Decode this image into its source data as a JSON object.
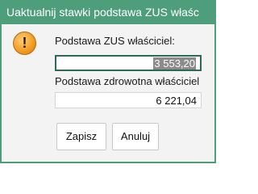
{
  "window": {
    "title": "Uaktualnij stawki podstawa ZUS właśc"
  },
  "form": {
    "zus_label": "Podstawa ZUS właściciel:",
    "zus_value": "3 553,20",
    "health_label": "Podstawa zdrowotna właściciel",
    "health_value": "6 221,04"
  },
  "buttons": {
    "save": "Zapisz",
    "cancel": "Anuluj"
  },
  "icons": {
    "dialog": "warning-icon"
  },
  "colors": {
    "titlebar": "#4e9e7c",
    "focus_border": "#2e6a52",
    "selection": "#8c8c8c"
  }
}
